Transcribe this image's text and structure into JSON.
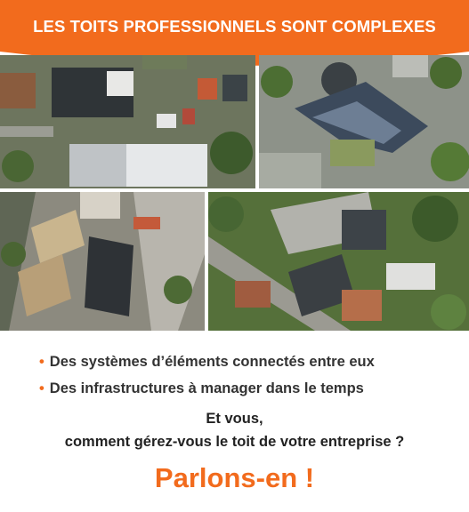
{
  "banner": {
    "title": "LES TOITS PROFESSIONNELS SONT COMPLEXES"
  },
  "bullets": [
    "Des systèmes d’éléments connectés entre eux",
    "Des infrastructures à manager dans le temps"
  ],
  "question": {
    "line1": "Et vous,",
    "line2": "comment gérez-vous le toit de votre entreprise ?"
  },
  "cta": "Parlons-en !",
  "colors": {
    "accent": "#f26b1d",
    "text": "#333333"
  },
  "photos": [
    "aerial-photo-1",
    "aerial-photo-2",
    "aerial-photo-3",
    "aerial-photo-4"
  ]
}
